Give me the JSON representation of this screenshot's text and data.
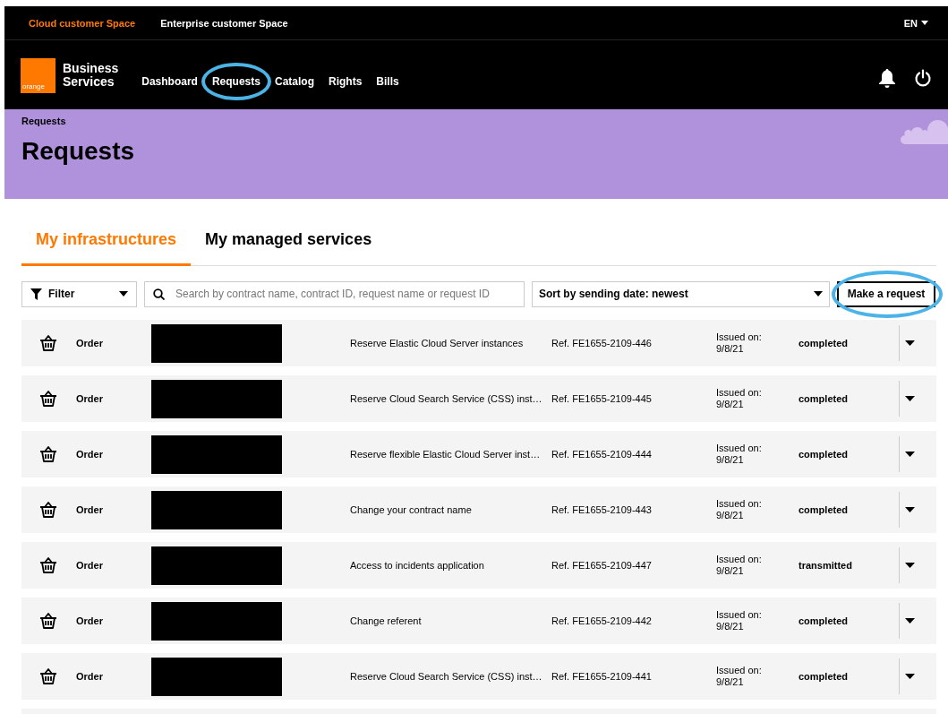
{
  "top_bar": {
    "spaces": [
      {
        "label": "Cloud customer Space",
        "selected": true
      },
      {
        "label": "Enterprise customer Space",
        "selected": false
      }
    ],
    "language": "EN"
  },
  "nav": {
    "brand": {
      "logo_text": "orange",
      "name_line_1": "Business",
      "name_line_2": "Services"
    },
    "items": [
      {
        "label": "Dashboard",
        "highlighted": false
      },
      {
        "label": "Requests",
        "highlighted": true
      },
      {
        "label": "Catalog",
        "highlighted": false
      },
      {
        "label": "Rights",
        "highlighted": false
      },
      {
        "label": "Bills",
        "highlighted": false
      }
    ]
  },
  "banner": {
    "breadcrumb": "Requests",
    "title": "Requests"
  },
  "tabs": [
    {
      "label": "My infrastructures",
      "selected": true
    },
    {
      "label": "My managed services",
      "selected": false
    }
  ],
  "toolbar": {
    "filter": "Filter",
    "search": {
      "placeholder": "Search by contract name, contract ID, request name or request ID"
    },
    "sort": "Sort by sending date: newest",
    "make_request": {
      "label": "Make a request",
      "highlighted": true
    }
  },
  "requests": [
    {
      "type": "Order",
      "name": "Reserve Elastic Cloud Server instances",
      "ref": "Ref. FE1655-2109-446",
      "issued_label": "Issued on:",
      "issued_date": "9/8/21",
      "status": "completed"
    },
    {
      "type": "Order",
      "name": "Reserve Cloud Search Service (CSS) inst…",
      "ref": "Ref. FE1655-2109-445",
      "issued_label": "Issued on:",
      "issued_date": "9/8/21",
      "status": "completed"
    },
    {
      "type": "Order",
      "name": "Reserve flexible Elastic Cloud Server inst…",
      "ref": "Ref. FE1655-2109-444",
      "issued_label": "Issued on:",
      "issued_date": "9/8/21",
      "status": "completed"
    },
    {
      "type": "Order",
      "name": "Change your contract name",
      "ref": "Ref. FE1655-2109-443",
      "issued_label": "Issued on:",
      "issued_date": "9/8/21",
      "status": "completed"
    },
    {
      "type": "Order",
      "name": "Access to incidents application",
      "ref": "Ref. FE1655-2109-447",
      "issued_label": "Issued on:",
      "issued_date": "9/8/21",
      "status": "transmitted"
    },
    {
      "type": "Order",
      "name": "Change referent",
      "ref": "Ref. FE1655-2109-442",
      "issued_label": "Issued on:",
      "issued_date": "9/8/21",
      "status": "completed"
    },
    {
      "type": "Order",
      "name": "Reserve Cloud Search Service (CSS) inst…",
      "ref": "Ref. FE1655-2109-441",
      "issued_label": "Issued on:",
      "issued_date": "9/8/21",
      "status": "completed"
    }
  ]
}
